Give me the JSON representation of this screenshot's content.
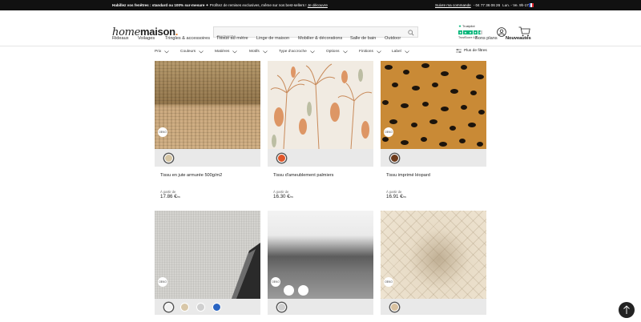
{
  "promo": {
    "lead": "Habillez vos fenêtres : standard ou 100% sur-mesure",
    "offer": " ✦ Profitez de remises exclusives, même sur nos best-sellers ! ",
    "link": "Je découvre",
    "track": "Suivre ma commande",
    "phone": "- 04 77 36 06 26",
    "hours": "Lun. - Ve. 9h-17h"
  },
  "header": {
    "logo_home": "home",
    "logo_maison": "maison",
    "logo_dot": ".",
    "search_placeholder": "Recherche",
    "trustpilot_label": "Trustpilot",
    "trustscore": "TrustScore 4.6",
    "rating_stars": 4.5
  },
  "nav": {
    "items": [
      "Rideaux",
      "Voilages",
      "Tringles & accessoires",
      "Tissus au mètre",
      "Linge de maison",
      "Mobilier & décorations",
      "Salle de bain",
      "Outdoor"
    ],
    "right": [
      "Bons plans",
      "Nouveautés"
    ]
  },
  "filters": {
    "items": [
      "Prix",
      "Couleurs",
      "Matières",
      "Motifs",
      "Type d'accroche",
      "Options",
      "Finitions",
      "Label"
    ],
    "more": "Plus de filtres"
  },
  "products": [
    {
      "title": "Tissu en jute armurée 500g/m2",
      "from": "À partir de",
      "price": "17.86 €",
      "unit": "/m",
      "badge": "OEKO",
      "swatches": [
        "#d6c6a4"
      ]
    },
    {
      "title": "Tissu d'ameublement palmiers",
      "from": "À partir de",
      "price": "16.30 €",
      "unit": "/m",
      "badge": "OEKO",
      "swatches": [
        "#e1572a"
      ]
    },
    {
      "title": "Tissu imprimé léopard",
      "from": "À partir de",
      "price": "16.91 €",
      "unit": "/m",
      "badge": "OEKO",
      "swatches": [
        "#6d3a1b"
      ]
    },
    {
      "title": "",
      "from": "",
      "price": "",
      "unit": "",
      "badge": "OEKO",
      "swatches": [
        "#f2f2f2",
        "#d8c7a8",
        "#cfcfcf",
        "#2964c2"
      ]
    },
    {
      "title": "",
      "from": "",
      "price": "",
      "unit": "",
      "badge": "OEKO",
      "swatches": [
        "#cfcfcf"
      ]
    },
    {
      "title": "",
      "from": "",
      "price": "",
      "unit": "",
      "badge": "OEKO",
      "swatches": [
        "#d9c2a0"
      ]
    }
  ],
  "colors": {
    "accent": "#e97a25",
    "trust_green": "#00b67a"
  }
}
